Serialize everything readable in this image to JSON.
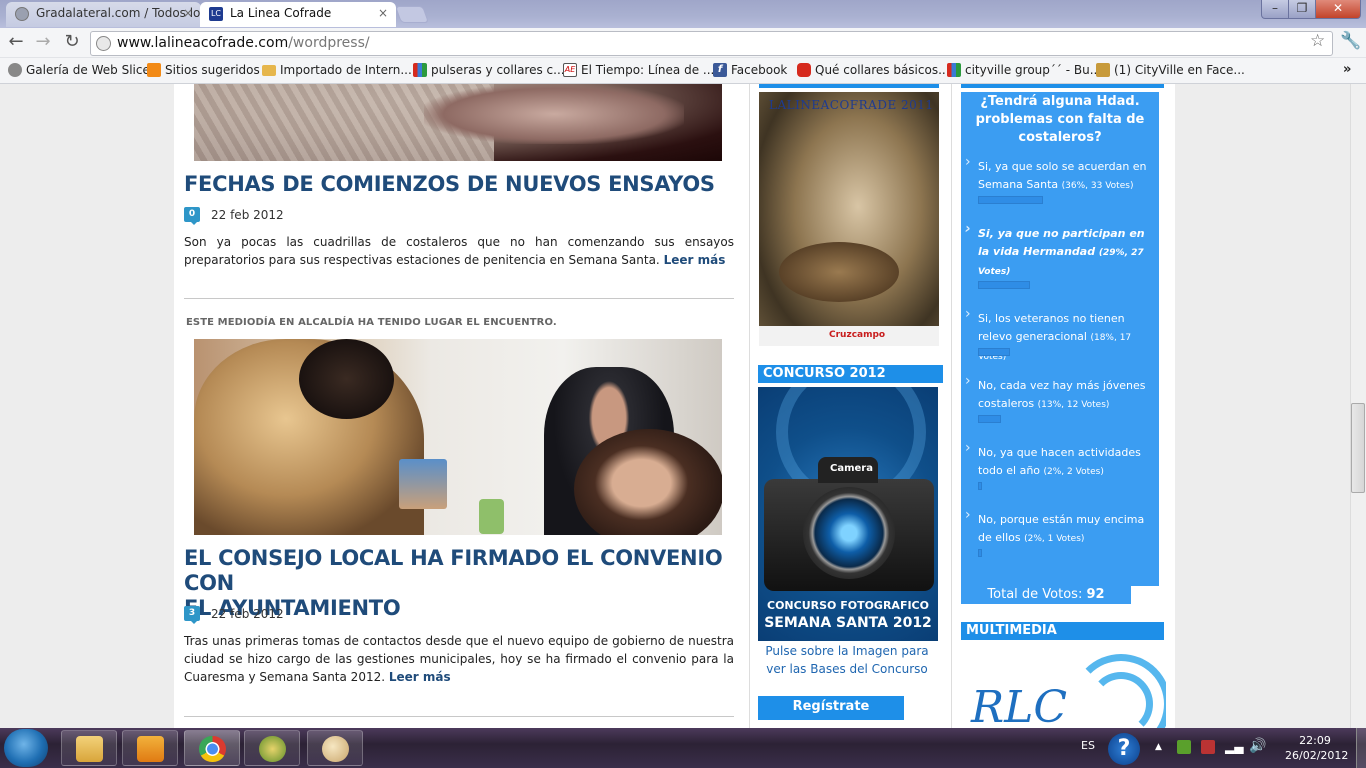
{
  "browser": {
    "tabs": [
      {
        "label": "Gradalateral.com / Todos lo",
        "active": false
      },
      {
        "label": "La Linea Cofrade",
        "active": true
      }
    ],
    "url_host": "www.lalineacofrade.com",
    "url_path": "/wordpress/"
  },
  "bookmarks": [
    {
      "label": "Galería de Web Slice",
      "icon": "web-slice-icon",
      "color": "#888888"
    },
    {
      "label": "Sitios sugeridos",
      "icon": "suggested-sites-icon",
      "color": "#f28a17"
    },
    {
      "label": "Importado de Intern...",
      "icon": "folder-icon",
      "color": "#e6b64c"
    },
    {
      "label": "pulseras y collares c...",
      "icon": "google-icon",
      "color": "#3a7bd5"
    },
    {
      "label": "El Tiempo: Línea de ...",
      "icon": "el-tiempo-icon",
      "color": "#555555"
    },
    {
      "label": "Facebook",
      "icon": "facebook-icon",
      "color": "#3b5998"
    },
    {
      "label": "Qué collares básicos...",
      "icon": "youtube-icon",
      "color": "#d62a1e"
    },
    {
      "label": "cityville group´´ - Bu...",
      "icon": "google-icon",
      "color": "#3a7bd5"
    },
    {
      "label": "(1) CityVille en Face...",
      "icon": "cityville-icon",
      "color": "#c79a3b"
    }
  ],
  "posts": [
    {
      "title": "FECHAS DE COMIENZOS DE NUEVOS ENSAYOS",
      "comments": "0",
      "date": "22 feb 2012",
      "excerpt": "Son ya pocas las cuadrillas de costaleros que no han comenzando sus ensayos preparatorios para sus respectivas estaciones de penitencia en Semana Santa.",
      "more": "Leer más"
    },
    {
      "caption": "ESTE MEDIODÍA EN ALCALDÍA HA TENIDO LUGAR EL ENCUENTRO.",
      "title_line1": "EL CONSEJO LOCAL HA FIRMADO EL CONVENIO CON",
      "title_line2": "EL AYUNTAMIENTO",
      "comments": "3",
      "date": "22 feb 2012",
      "excerpt": "Tras unas primeras tomas de contactos desde que el nuevo equipo de gobierno de nuestra ciudad se hizo cargo de las gestiones municipales, hoy se ha firmado el convenio para la Cuaresma y Semana Santa 2012.",
      "more": "Leer más"
    }
  ],
  "middle": {
    "poster1_title": "LALINEACOFRADE 2011",
    "poster1_brand": "Cruzcampo",
    "contest_heading": "CONCURSO 2012",
    "camera_label": "Camera",
    "contest_line1": "CONCURSO FOTOGRAFICO",
    "contest_line2": "SEMANA SANTA 2012",
    "contest_note_line1": "Pulse sobre la Imagen para",
    "contest_note_line2": "ver las Bases del Concurso",
    "register": "Regístrate"
  },
  "poll": {
    "question_line1": "¿Tendrá alguna Hdad.",
    "question_line2": "problemas con falta de",
    "question_line3": "costaleros?",
    "options": [
      {
        "text": "Si, ya que solo se acuerdan en Semana Santa",
        "stats": "(36%, 33 Votes)",
        "percent": 36,
        "selected": false
      },
      {
        "text": "Si, ya que no participan en la vida Hermandad",
        "stats": "(29%, 27 Votes)",
        "percent": 29,
        "selected": true
      },
      {
        "text": "Si, los veteranos no tienen relevo generacional",
        "stats": "(18%, 17 Votes)",
        "percent": 18,
        "selected": false
      },
      {
        "text": "No, cada vez hay más jóvenes costaleros",
        "stats": "(13%, 12 Votes)",
        "percent": 13,
        "selected": false
      },
      {
        "text": "No, ya que hacen actividades todo el año",
        "stats": "(2%, 2 Votes)",
        "percent": 2,
        "selected": false
      },
      {
        "text": "No, porque están muy encima de ellos",
        "stats": "(2%, 1 Votes)",
        "percent": 2,
        "selected": false
      }
    ],
    "total_label": "Total de Votos:",
    "total_value": "92"
  },
  "multimedia": {
    "heading": "MULTIMEDIA",
    "logo_text": "RLC"
  },
  "taskbar": {
    "lang": "ES",
    "time": "22:09",
    "date": "26/02/2012"
  },
  "colors": {
    "accent": "#1e8fe8",
    "title": "#1f4b7a",
    "poll_bg": "#3b9df2"
  }
}
